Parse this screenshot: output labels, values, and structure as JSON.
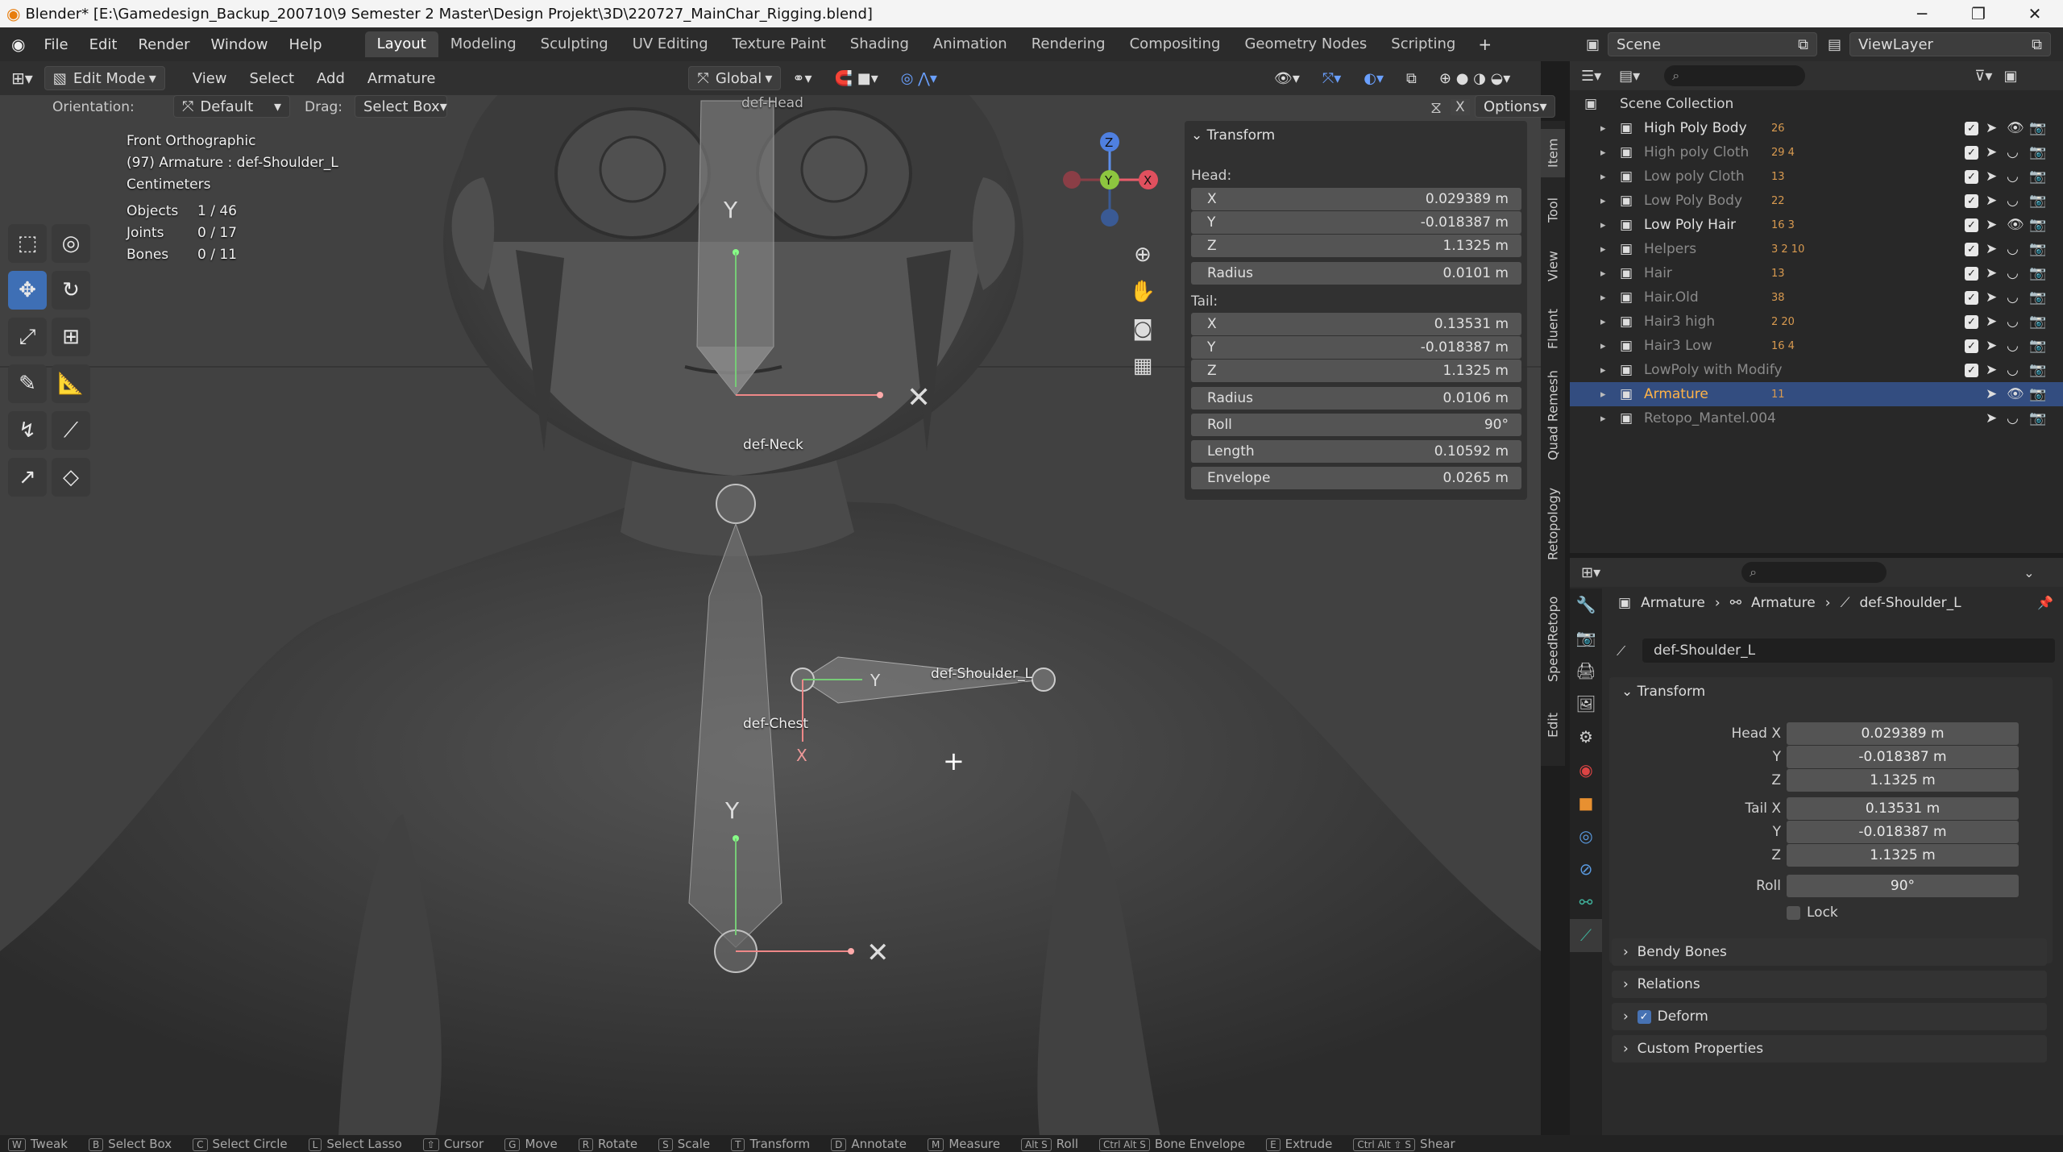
{
  "window": {
    "title": "Blender* [E:\\Gamedesign_Backup_200710\\9 Semester 2 Master\\Design Projekt\\3D\\220727_MainChar_Rigging.blend]"
  },
  "menu": [
    "File",
    "Edit",
    "Render",
    "Window",
    "Help"
  ],
  "workspaces": [
    "Layout",
    "Modeling",
    "Sculpting",
    "UV Editing",
    "Texture Paint",
    "Shading",
    "Animation",
    "Rendering",
    "Compositing",
    "Geometry Nodes",
    "Scripting"
  ],
  "scene": "Scene",
  "view_layer": "ViewLayer",
  "header": {
    "mode": "Edit Mode",
    "view": "View",
    "select": "Select",
    "add": "Add",
    "armature": "Armature",
    "transform_orientation": "Global"
  },
  "toolsettings": {
    "orientation_label": "Orientation:",
    "orientation": "Default",
    "drag_label": "Drag:",
    "drag": "Select Box",
    "options": "Options"
  },
  "overlay": {
    "view": "Front Orthographic",
    "object": "(97) Armature : def-Shoulder_L",
    "units": "Centimeters",
    "stats": [
      {
        "label": "Objects",
        "value": "1 / 46"
      },
      {
        "label": "Joints",
        "value": "0 / 17"
      },
      {
        "label": "Bones",
        "value": "0 / 11"
      }
    ]
  },
  "bones": {
    "head": "def-Head",
    "neck": "def-Neck",
    "chest": "def-Chest",
    "shoulder": "def-Shoulder_L"
  },
  "npanel": {
    "title": "Transform",
    "head_label": "Head:",
    "tail_label": "Tail:",
    "head": {
      "x": "0.029389 m",
      "y": "-0.018387 m",
      "z": "1.1325 m",
      "radius": "0.0101 m"
    },
    "tail": {
      "x": "0.13531 m",
      "y": "-0.018387 m",
      "z": "1.1325 m",
      "radius": "0.0106 m"
    },
    "roll": "90°",
    "length": "0.10592 m",
    "envelope": "0.0265 m",
    "labels": {
      "x": "X",
      "y": "Y",
      "z": "Z",
      "radius": "Radius",
      "roll": "Roll",
      "length": "Length",
      "envelope": "Envelope"
    }
  },
  "sidetabs": [
    "Item",
    "Tool",
    "View",
    "Fluent",
    "Quad Remesh",
    "Retopology",
    "SpeedRetopo",
    "Edit"
  ],
  "outliner": {
    "root": "Scene Collection",
    "items": [
      {
        "name": "High Poly Body",
        "badges": "26",
        "dim": false
      },
      {
        "name": "High poly Cloth",
        "badges": "29  4",
        "dim": true
      },
      {
        "name": "Low poly Cloth",
        "badges": "13",
        "dim": true
      },
      {
        "name": "Low Poly Body",
        "badges": "22",
        "dim": true
      },
      {
        "name": "Low Poly Hair",
        "badges": "16  3",
        "dim": false
      },
      {
        "name": "Helpers",
        "badges": "3   2  10",
        "dim": true
      },
      {
        "name": "Hair",
        "badges": "13",
        "dim": true
      },
      {
        "name": "Hair.Old",
        "badges": "38",
        "dim": true
      },
      {
        "name": "Hair3 high",
        "badges": "2  20",
        "dim": true
      },
      {
        "name": "Hair3 Low",
        "badges": "16  4",
        "dim": true
      },
      {
        "name": "LowPoly with Modify",
        "badges": "",
        "dim": true
      },
      {
        "name": "Armature",
        "badges": "11",
        "dim": false
      },
      {
        "name": "Retopo_Mantel.004",
        "badges": "",
        "dim": true
      }
    ]
  },
  "properties": {
    "breadcrumb": [
      "Armature",
      "Armature",
      "def-Shoulder_L"
    ],
    "bone_name": "def-Shoulder_L",
    "transform": "Transform",
    "head_x_label": "Head X",
    "tail_x_label": "Tail X",
    "y_label": "Y",
    "z_label": "Z",
    "roll_label": "Roll",
    "lock": "Lock",
    "values": {
      "hx": "0.029389 m",
      "hy": "-0.018387 m",
      "hz": "1.1325 m",
      "tx": "0.13531 m",
      "ty": "-0.018387 m",
      "tz": "1.1325 m",
      "roll": "90°"
    },
    "sections": [
      "Bendy Bones",
      "Relations",
      "Deform",
      "Custom Properties"
    ]
  },
  "statusbar": [
    {
      "key": "W",
      "label": "Tweak"
    },
    {
      "key": "B",
      "label": "Select Box"
    },
    {
      "key": "C",
      "label": "Select Circle"
    },
    {
      "key": "L",
      "label": "Select Lasso"
    },
    {
      "key": "⇧",
      "label": "Cursor"
    },
    {
      "key": "G",
      "label": "Move"
    },
    {
      "key": "R",
      "label": "Rotate"
    },
    {
      "key": "S",
      "label": "Scale"
    },
    {
      "key": "T",
      "label": "Transform"
    },
    {
      "key": "D",
      "label": "Annotate"
    },
    {
      "key": "M",
      "label": "Measure"
    },
    {
      "key": "Alt S",
      "label": "Roll"
    },
    {
      "key": "Ctrl Alt S",
      "label": "Bone Envelope"
    },
    {
      "key": "E",
      "label": "Extrude"
    },
    {
      "key": "Ctrl Alt ⇧ S",
      "label": "Shear"
    }
  ],
  "colors": {
    "accent": "#4772b3",
    "selected_row": "#334d80",
    "bone_orange": "#e8a040"
  }
}
